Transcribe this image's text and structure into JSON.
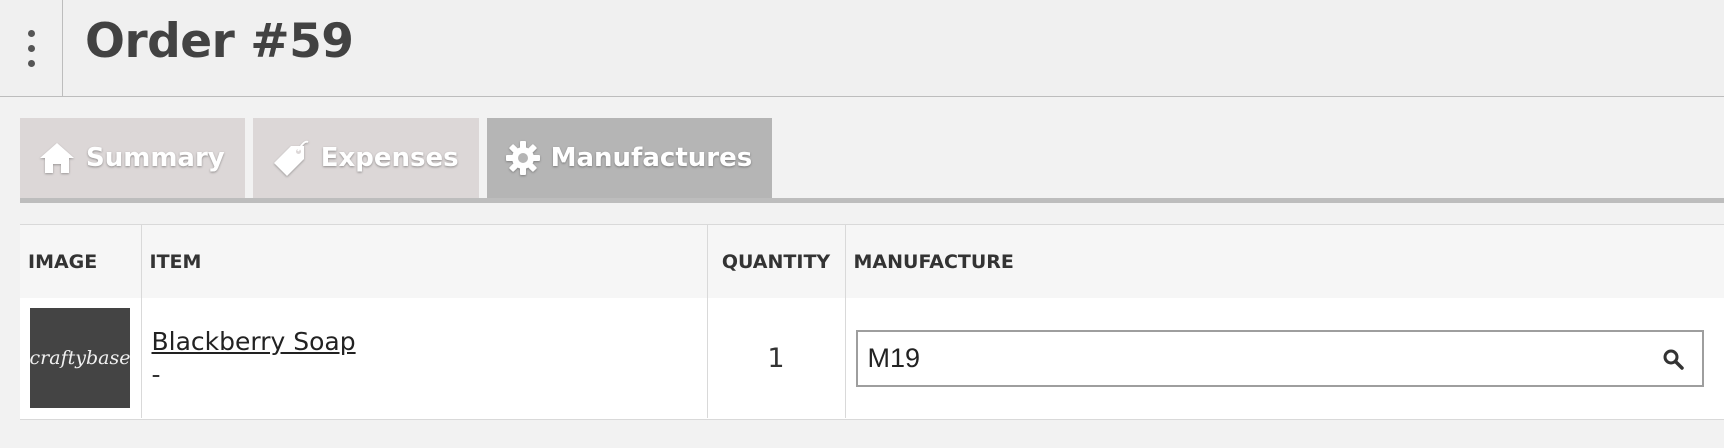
{
  "header": {
    "title": "Order #59",
    "menu_icon": "kebab-menu-icon"
  },
  "tabs": [
    {
      "label": "Summary",
      "icon": "home-icon",
      "active": false
    },
    {
      "label": "Expenses",
      "icon": "price-tag-icon",
      "active": false
    },
    {
      "label": "Manufactures",
      "icon": "gear-icon",
      "active": true
    }
  ],
  "table": {
    "columns": [
      "IMAGE",
      "ITEM",
      "QUANTITY",
      "MANUFACTURE"
    ],
    "rows": [
      {
        "image_text": "craftybase",
        "item_name": "Blackberry Soap",
        "item_sub": "-",
        "quantity": "1",
        "manufacture_value": "M19"
      }
    ]
  },
  "colors": {
    "tab_inactive": "#dcd7d7",
    "tab_active": "#b5b5b5",
    "header_bg": "#f0f0f0"
  }
}
